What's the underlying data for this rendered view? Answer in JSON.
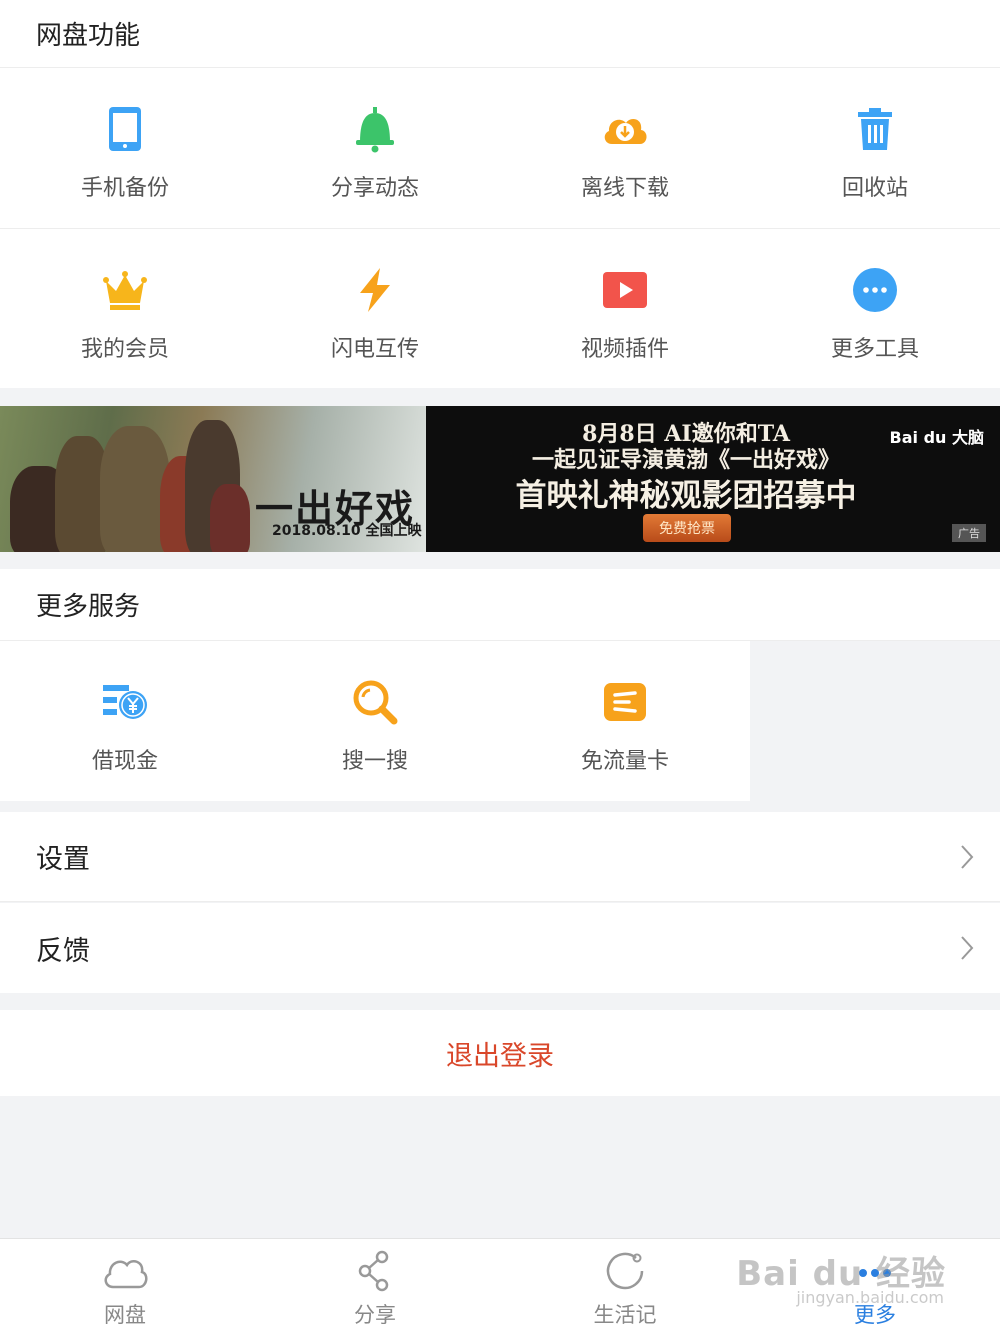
{
  "section_netdisk": {
    "title": "网盘功能",
    "items": [
      {
        "label": "手机备份",
        "icon": "phone-icon"
      },
      {
        "label": "分享动态",
        "icon": "bell-icon"
      },
      {
        "label": "离线下载",
        "icon": "cloud-download-icon"
      },
      {
        "label": "回收站",
        "icon": "trash-icon"
      },
      {
        "label": "我的会员",
        "icon": "crown-icon"
      },
      {
        "label": "闪电互传",
        "icon": "lightning-icon"
      },
      {
        "label": "视频插件",
        "icon": "play-icon"
      },
      {
        "label": "更多工具",
        "icon": "more-dots-icon"
      }
    ]
  },
  "banner": {
    "poster_title": "一出好戏",
    "poster_date": "2018.08.10 全国上映",
    "line1": "8月8日 AI邀你和TA",
    "line2": "一起见证导演黄渤《一出好戏》",
    "line3": "首映礼神秘观影团招募中",
    "button": "免费抢票",
    "logo": "Bai du 大脑",
    "ad_tag": "广告"
  },
  "section_services": {
    "title": "更多服务",
    "items": [
      {
        "label": "借现金",
        "icon": "cash-loan-icon"
      },
      {
        "label": "搜一搜",
        "icon": "search-icon"
      },
      {
        "label": "免流量卡",
        "icon": "sim-card-icon"
      }
    ]
  },
  "list": {
    "settings": "设置",
    "feedback": "反馈"
  },
  "logout": "退出登录",
  "tabbar": {
    "items": [
      {
        "label": "网盘",
        "icon": "cloud-icon"
      },
      {
        "label": "分享",
        "icon": "share-icon"
      },
      {
        "label": "生活记",
        "icon": "refresh-circle-icon"
      },
      {
        "label": "更多",
        "icon": "more-icon"
      }
    ],
    "active_index": 3
  },
  "watermark": {
    "main": "Bai du 经验",
    "sub": "jingyan.baidu.com"
  },
  "colors": {
    "blue": "#3da3f5",
    "green": "#3cc46a",
    "orange": "#f7a21b",
    "red": "#f2544b",
    "logout_red": "#d9472a",
    "active_tab": "#2a7fe0"
  }
}
